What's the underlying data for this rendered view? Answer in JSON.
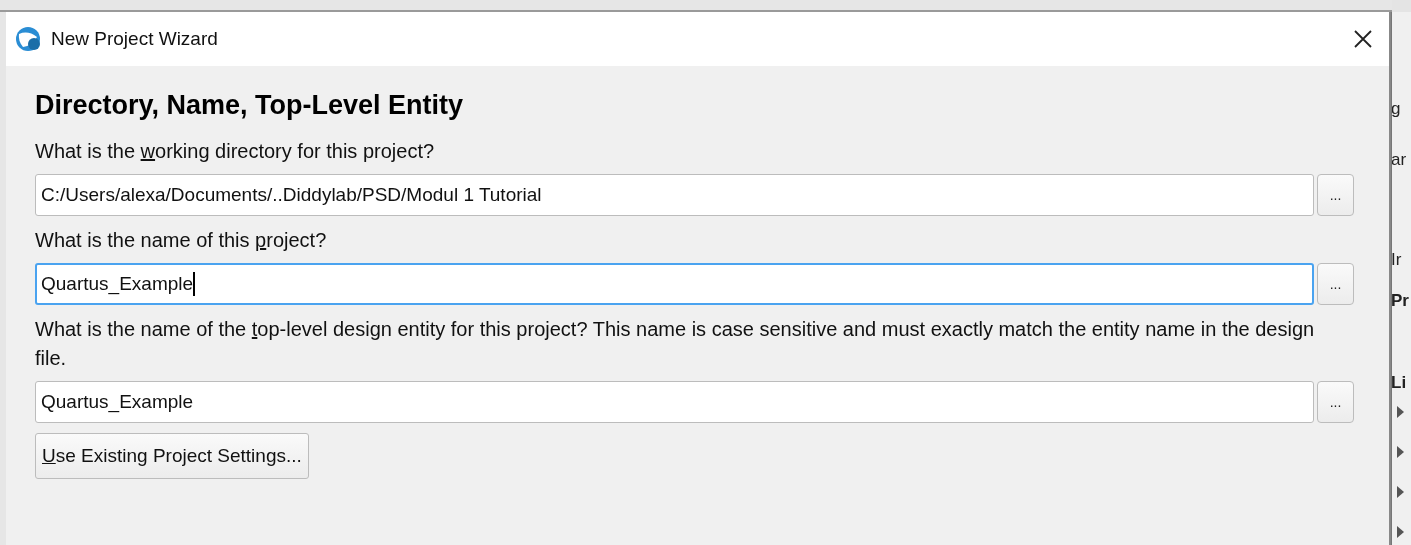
{
  "window": {
    "title": "New Project Wizard"
  },
  "page_heading": "Directory, Name, Top-Level Entity",
  "fields": [
    {
      "label": [
        "What is the ",
        "w",
        "orking directory for this project?"
      ],
      "value": "C:/Users/alexa/Documents/..Diddylab/PSD/Modul 1 Tutorial",
      "focused": false,
      "browse": "..."
    },
    {
      "label": [
        "What is the name of this ",
        "p",
        "roject?"
      ],
      "value": "Quartus_Example",
      "focused": true,
      "browse": "..."
    },
    {
      "label": [
        "What is the name of the ",
        "t",
        "op-level design entity for this project? This name is case sensitive and must exactly match the entity name in the design file."
      ],
      "value": "Quartus_Example",
      "focused": false,
      "browse": "..."
    }
  ],
  "settings_button": {
    "key": "U",
    "rest": "se Existing Project Settings..."
  },
  "background_window": {
    "texts": [
      {
        "text": "g",
        "kind": "plain"
      },
      {
        "text": "ar",
        "kind": "plain"
      },
      {
        "text": "Ir",
        "kind": "plain"
      },
      {
        "text": "Pr",
        "kind": "bold"
      },
      {
        "text": "Li",
        "kind": "bold"
      }
    ]
  }
}
